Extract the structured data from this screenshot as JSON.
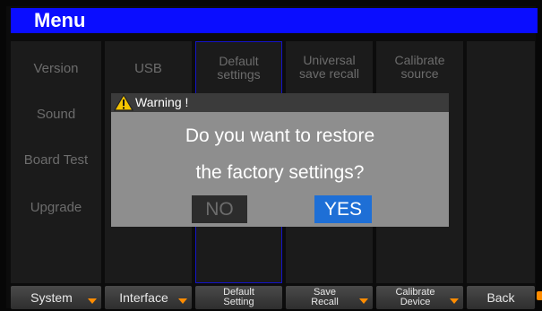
{
  "title": "Menu",
  "left_menu": [
    "Version",
    "Sound",
    "Board Test",
    "Upgrade"
  ],
  "tabs": [
    {
      "label": "USB",
      "selected": false
    },
    {
      "label": "Default\nsettings",
      "selected": true
    },
    {
      "label": "Universal\nsave recall",
      "selected": false
    },
    {
      "label": "Calibrate\nsource",
      "selected": false
    }
  ],
  "softkeys": [
    {
      "label": "System",
      "arrow": true
    },
    {
      "label": "Interface",
      "arrow": true
    },
    {
      "label": "Default\nSetting",
      "arrow": false
    },
    {
      "label": "Save\nRecall",
      "arrow": true
    },
    {
      "label": "Calibrate\nDevice",
      "arrow": true
    },
    {
      "label": "Back",
      "arrow": false
    }
  ],
  "dialog": {
    "header": "Warning !",
    "line1": "Do you want to restore",
    "line2": "the factory settings?",
    "no_label": "NO",
    "yes_label": "YES",
    "selected": "YES"
  },
  "colors": {
    "title_bar": "#0a0dff",
    "accent_arrow": "#ff8c00",
    "yes_button": "#1e6fd6",
    "dialog_bg": "#8e8e8e"
  },
  "icons": {
    "warning": "warning-triangle-icon",
    "dropdown": "chevron-down-icon"
  }
}
